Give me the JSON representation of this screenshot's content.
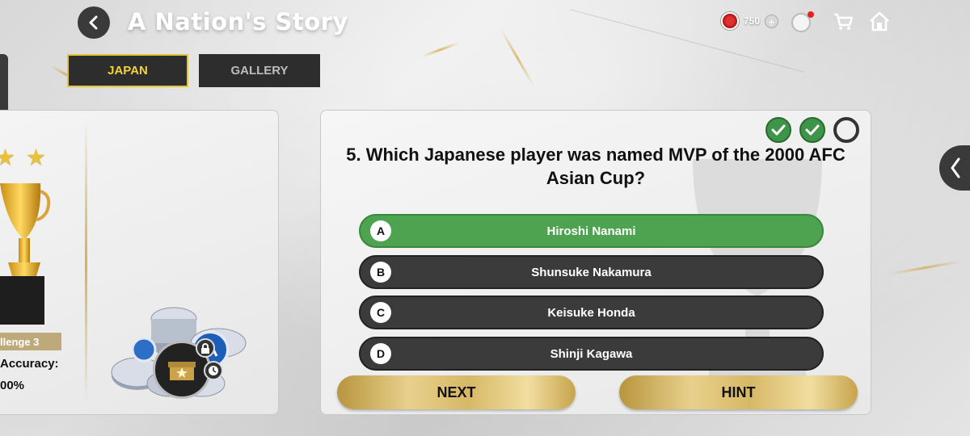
{
  "header": {
    "title": "A Nation's Story",
    "coins": "750"
  },
  "tabs": [
    {
      "label": "JAPAN",
      "active": true
    },
    {
      "label": "GALLERY",
      "active": false
    }
  ],
  "left_card": {
    "challenge_label": "llenge 3",
    "accuracy_label": "Accuracy:",
    "accuracy_value": "00%",
    "stars": 2
  },
  "quiz": {
    "progress": [
      {
        "state": "correct"
      },
      {
        "state": "correct"
      },
      {
        "state": "pending"
      }
    ],
    "question": "5. Which Japanese player was named MVP of the 2000 AFC Asian Cup?",
    "answers": [
      {
        "letter": "A",
        "text": "Hiroshi Nanami",
        "state": "correct"
      },
      {
        "letter": "B",
        "text": "Shunsuke Nakamura",
        "state": "default"
      },
      {
        "letter": "C",
        "text": "Keisuke Honda",
        "state": "default"
      },
      {
        "letter": "D",
        "text": "Shinji Kagawa",
        "state": "default"
      }
    ],
    "next_label": "NEXT",
    "hint_label": "HINT"
  },
  "colors": {
    "tab_active_accent": "#e2c33c",
    "correct_green": "#4da34f",
    "answer_dark": "#3b3b3b",
    "gold_button": "#d7b866"
  }
}
